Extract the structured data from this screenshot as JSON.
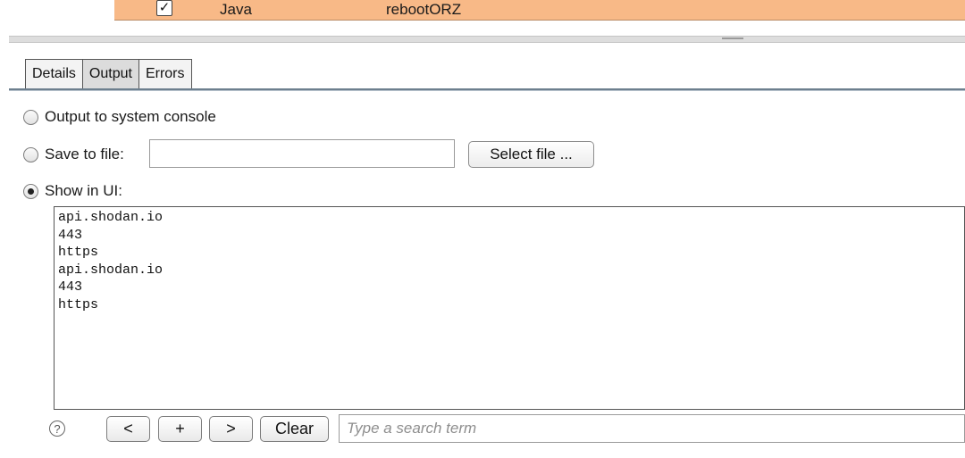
{
  "table": {
    "row": {
      "checked_glyph": "✓",
      "type": "Java",
      "name": "rebootORZ"
    }
  },
  "tabs": [
    {
      "label": "Details"
    },
    {
      "label": "Output"
    },
    {
      "label": "Errors"
    }
  ],
  "output": {
    "console_label": "Output to system console",
    "file_label": "Save to file:",
    "file_value": "",
    "select_file_label": "Select file ...",
    "ui_label": "Show in UI:",
    "selected": "Show in UI",
    "lines": [
      "api.shodan.io",
      "443",
      "https",
      "api.shodan.io",
      "443",
      "https"
    ]
  },
  "bottom_bar": {
    "help_glyph": "?",
    "prev_label": "<",
    "add_label": "+",
    "next_label": ">",
    "clear_label": "Clear",
    "search_placeholder": "Type a search term"
  },
  "colors": {
    "selected_row": "#f8b987",
    "tab_border": "#555555"
  }
}
